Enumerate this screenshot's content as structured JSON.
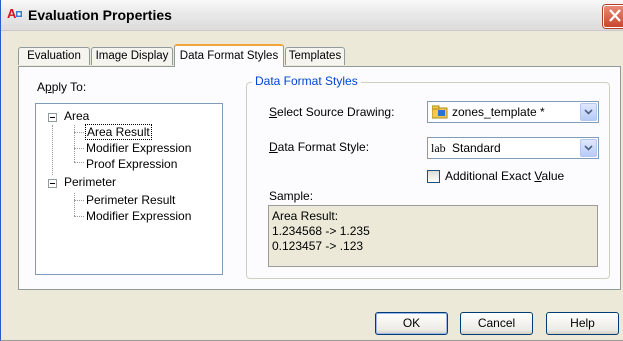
{
  "window": {
    "title": "Evaluation Properties",
    "app_icon_letter": "A",
    "close_symbol": "×"
  },
  "tabs": [
    {
      "label": "Evaluation"
    },
    {
      "label": "Image Display"
    },
    {
      "label": "Data Format Styles",
      "active": true
    },
    {
      "label": "Templates"
    }
  ],
  "apply_to": {
    "label_mnemonic": "p",
    "label_pre": "A",
    "label_post": "ply To:",
    "tree": [
      {
        "label": "Area",
        "expander": "-",
        "children": [
          "Area Result",
          "Modifier Expression",
          "Proof Expression"
        ]
      },
      {
        "label": "Perimeter",
        "expander": "-",
        "children": [
          "Perimeter Result",
          "Modifier Expression"
        ]
      }
    ],
    "selected": "Area Result"
  },
  "data_format_styles": {
    "group_title": "Data Format Styles",
    "source_drawing": {
      "label_mnemonic": "S",
      "label_rest": "elect Source Drawing:",
      "value": "zones_template *",
      "icon": "drawing-folder-icon"
    },
    "style": {
      "label_mnemonic": "D",
      "label_rest": "ata Format Style:",
      "value": "Standard",
      "icon_text": "lab"
    },
    "exact_value": {
      "label_pre": "Additional Exact ",
      "label_mnemonic": "V",
      "label_post": "alue",
      "checked": false
    },
    "sample": {
      "label": "Sample:",
      "lines": [
        "Area Result:",
        "1.234568 -> 1.235",
        "0.123457 -> .123"
      ]
    }
  },
  "buttons": {
    "ok": "OK",
    "cancel": "Cancel",
    "help": "Help"
  },
  "colors": {
    "accent_tab": "#f0a43c",
    "group_title": "#0046d5",
    "close_button": "#c9452c"
  }
}
